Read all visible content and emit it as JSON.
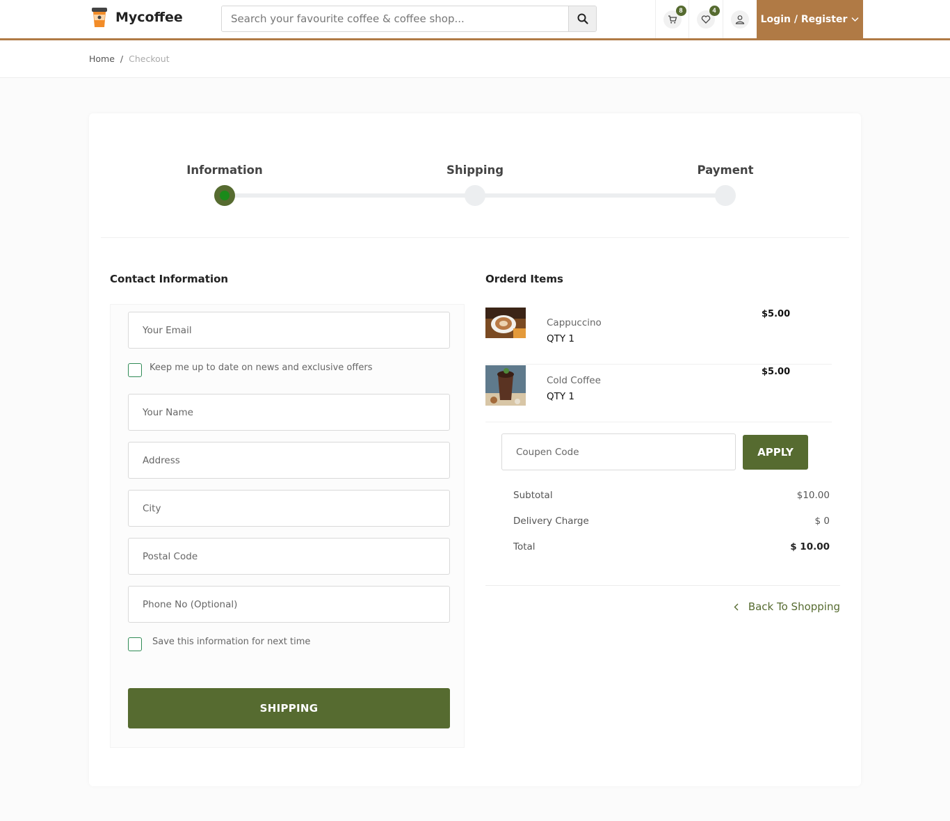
{
  "header": {
    "brand": "Mycoffee",
    "search_placeholder": "Search your favourite coffee & coffee shop...",
    "cart_count": "8",
    "wishlist_count": "4",
    "login_label": "Login / Register"
  },
  "breadcrumb": {
    "home": "Home",
    "separator": "/",
    "current": "Checkout"
  },
  "steps": {
    "items": [
      "Information",
      "Shipping",
      "Payment"
    ],
    "active_index": 0
  },
  "contact": {
    "title": "Contact Information",
    "email_placeholder": "Your Email",
    "newsletter_label": "Keep me up to date on news and exclusive offers",
    "name_placeholder": "Your Name",
    "address_placeholder": "Address",
    "city_placeholder": "City",
    "postal_placeholder": "Postal Code",
    "phone_placeholder": "Phone No (Optional)",
    "save_info_label": "Save this information for next time",
    "submit_label": "SHIPPING"
  },
  "order": {
    "title": "Orderd Items",
    "items": [
      {
        "name": "Cappuccino",
        "qty": "QTY 1",
        "price": "$5.00"
      },
      {
        "name": "Cold Coffee",
        "qty": "QTY 1",
        "price": "$5.00"
      }
    ],
    "coupon_placeholder": "Coupen Code",
    "apply_label": "APPLY",
    "subtotal_label": "Subtotal",
    "subtotal_value": "$10.00",
    "delivery_label": "Delivery Charge",
    "delivery_value": "$ 0",
    "total_label": "Total",
    "total_value": "$ 10.00",
    "back_label": "Back To Shopping"
  },
  "colors": {
    "brand_brown": "#b07a45",
    "accent_green": "#566b30"
  }
}
